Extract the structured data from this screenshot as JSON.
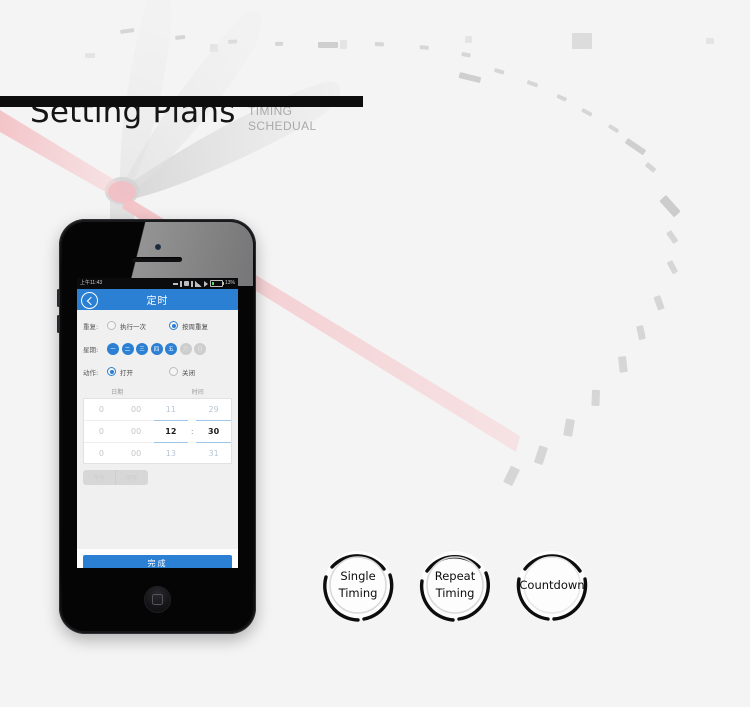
{
  "header": {
    "title": "Setting Plans",
    "subtitle_line1": "TIMING",
    "subtitle_line2": "SCHEDUAL"
  },
  "colors": {
    "accent_blue": "#2c80d3",
    "rule_black": "#0d0d0d",
    "page_background": "#f4f4f4",
    "blade_gray": "#d9d9d9",
    "clock_hand_pink": "#f0b6bb",
    "day_active": "#2c80d3",
    "day_inactive": "#cdcdcd"
  },
  "phone": {
    "statusbar": {
      "time": "上午11:43",
      "battery_percent": "13%",
      "icons": [
        "dash-icon",
        "signal-bar-icon",
        "app-square-icon",
        "small-square-icon",
        "signal-icon",
        "play-triangle-icon",
        "battery-icon"
      ]
    },
    "appbar": {
      "back_icon": "chevron-left-icon",
      "title": "定时"
    },
    "form": {
      "rows": [
        {
          "label": "重复:",
          "options": [
            {
              "text": "执行一次",
              "selected": false
            },
            {
              "text": "按周重复",
              "selected": true
            }
          ]
        },
        {
          "label": "星期:",
          "days": [
            {
              "text": "一",
              "active": true
            },
            {
              "text": "二",
              "active": true
            },
            {
              "text": "三",
              "active": true
            },
            {
              "text": "四",
              "active": true
            },
            {
              "text": "五",
              "active": true
            },
            {
              "text": "六",
              "active": false
            },
            {
              "text": "日",
              "active": false
            }
          ]
        },
        {
          "label": "动作:",
          "options": [
            {
              "text": "打开",
              "selected": true
            },
            {
              "text": "关闭",
              "selected": false
            }
          ]
        }
      ],
      "picker": {
        "head_date": "日期",
        "head_time": "时间",
        "date_col1": [
          "0",
          "0",
          "0"
        ],
        "date_col2": [
          "00",
          "00",
          "00"
        ],
        "hour_col": [
          "11",
          "12",
          "13"
        ],
        "separator": ":",
        "minute_col": [
          "29",
          "30",
          "31"
        ],
        "selected_hour": "12",
        "selected_minute": "30"
      },
      "segments": [
        "今年",
        "明年"
      ],
      "done_button": "完成"
    },
    "home_button_icon": "home-square-icon"
  },
  "badges": [
    {
      "line1": "Single",
      "line2": "Timing",
      "name": "single-timing"
    },
    {
      "line1": "Repeat",
      "line2": "Timing",
      "name": "repeat-timing"
    },
    {
      "line1": "Countdown",
      "line2": "",
      "name": "countdown"
    }
  ]
}
